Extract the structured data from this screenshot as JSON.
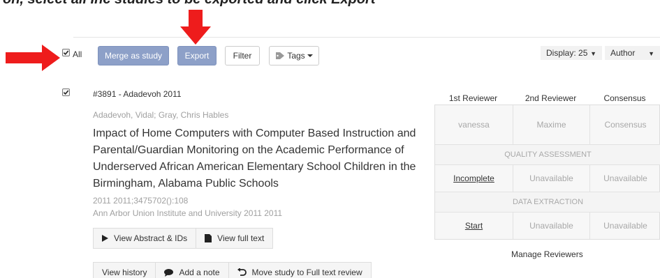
{
  "caption": "on, select all Inc studies to be exported and click Export",
  "toolbar": {
    "select_all_label": "All",
    "merge_label": "Merge as study",
    "export_label": "Export",
    "filter_label": "Filter",
    "tags_label": "Tags",
    "display_label": "Display: 25",
    "sort_label": "Author"
  },
  "study": {
    "id_line": "#3891 - Adadevoh 2011",
    "authors": "Adadevoh, Vidal; Gray, Chris Hables",
    "title": "Impact of Home Computers with Computer Based Instruction and Parental/Guardian Monitoring on the Academic Performance of Underserved African American Elementary School Children in the Birmingham, Alabama Public Schools",
    "citation_line1": "2011 2011;3475702():108",
    "citation_line2": "Ann Arbor Union Institute and University 2011 2011",
    "view_abstract_label": "View Abstract & IDs",
    "view_fulltext_label": "View full text",
    "view_history_label": "View history",
    "add_note_label": "Add a note",
    "move_label": "Move study to Full text review"
  },
  "reviewers": {
    "headers": [
      "1st Reviewer",
      "2nd Reviewer",
      "Consensus"
    ],
    "names": [
      "vanessa",
      "Maxime",
      "Consensus"
    ],
    "quality_section": "QUALITY ASSESSMENT",
    "quality_row": [
      "Incomplete",
      "Unavailable",
      "Unavailable"
    ],
    "extraction_section": "DATA EXTRACTION",
    "extraction_row": [
      "Start",
      "Unavailable",
      "Unavailable"
    ],
    "manage_label": "Manage Reviewers"
  },
  "colors": {
    "primary_button": "#8da0c8",
    "annotation_arrow": "#ee1c1c"
  }
}
